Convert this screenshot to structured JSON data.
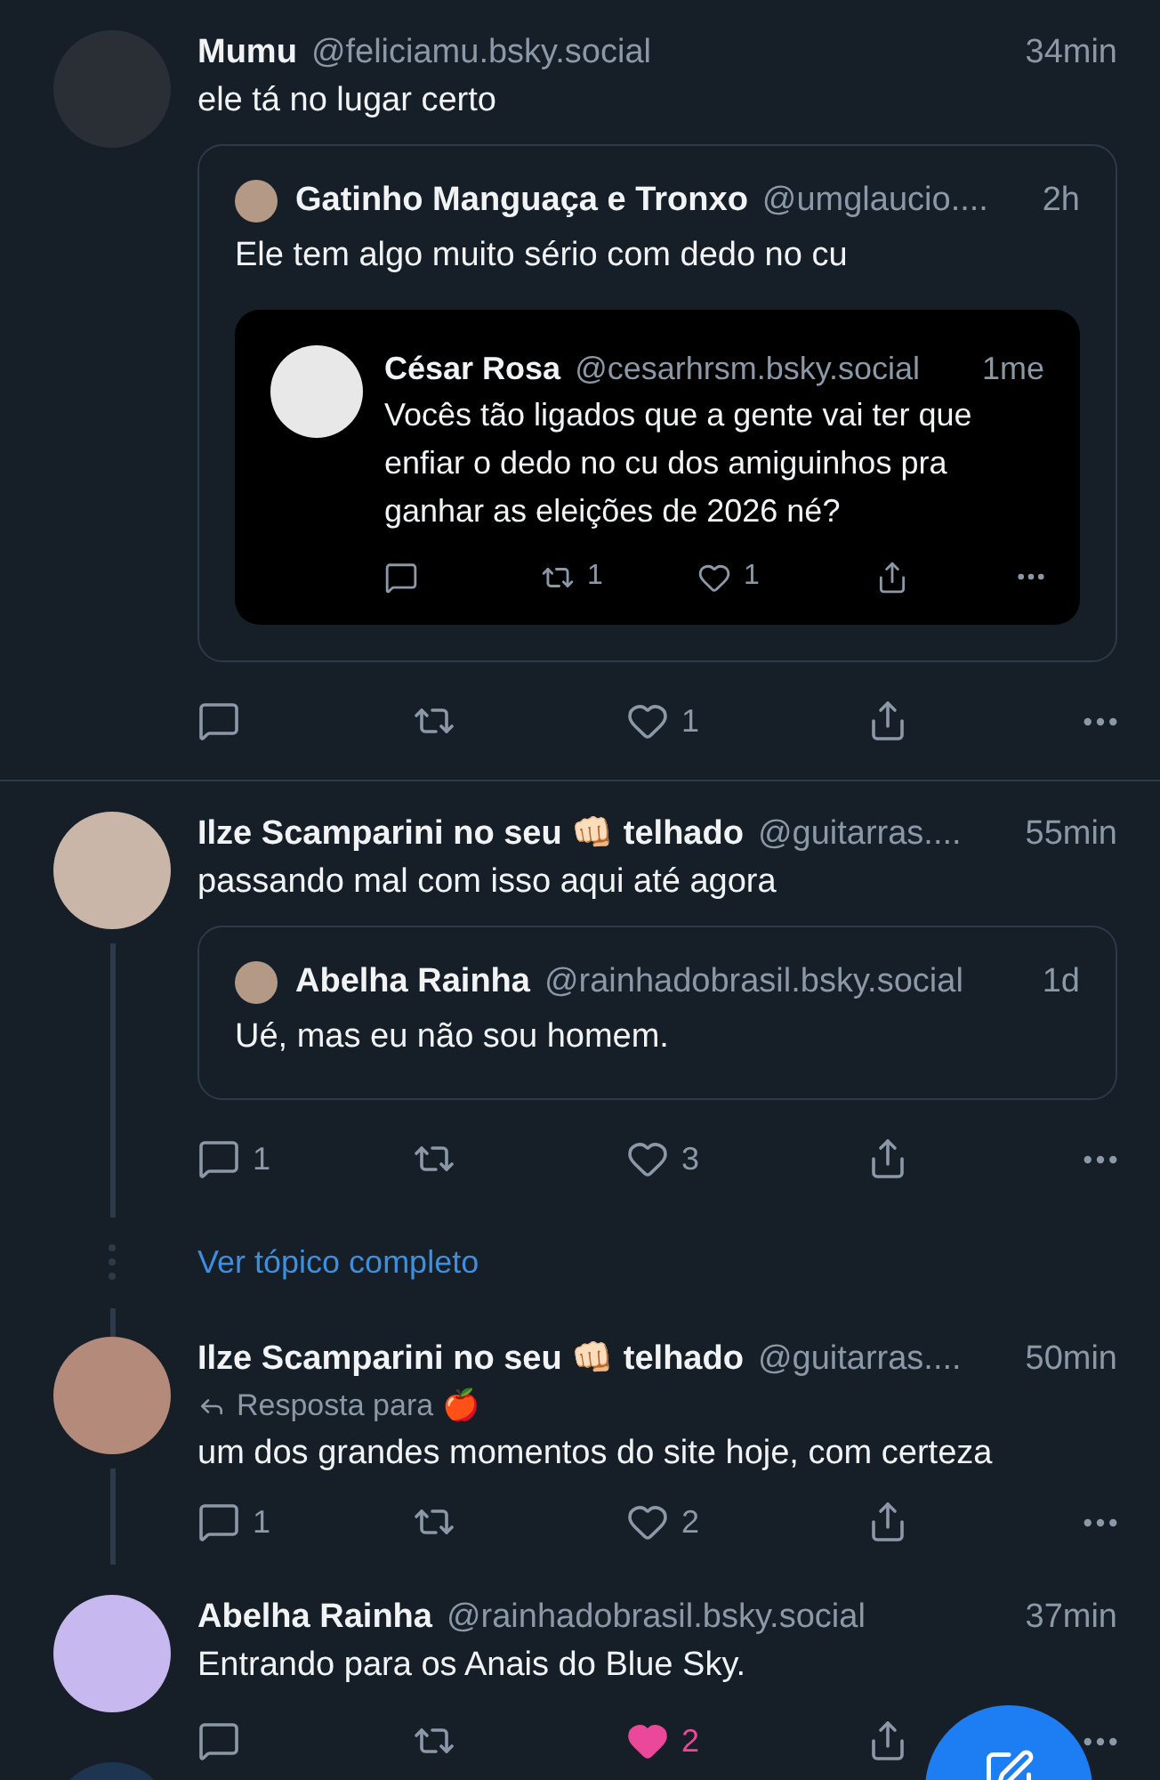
{
  "posts": [
    {
      "author": "Mumu",
      "handle": "@feliciamu.bsky.social",
      "time": "34min",
      "text": "ele tá no lugar certo",
      "divider_above": false,
      "line_above": false,
      "line_below": false,
      "quote": {
        "author": "Gatinho Manguaça e Tronxo",
        "handle": "@umglaucio....",
        "time": "2h",
        "text": "Ele tem algo muito sério com dedo no cu",
        "quote": {
          "author": "César Rosa",
          "handle": "@cesarhrsm.bsky.social",
          "time": "1me",
          "text": "Vocês tão ligados que a gente vai ter que enfiar o dedo no cu dos amiguinhos pra ganhar as eleições de 2026 né?",
          "actions": [
            {
              "kind": "reply"
            },
            {
              "kind": "repost",
              "count": "1"
            },
            {
              "kind": "like",
              "count": "1",
              "liked": false
            },
            {
              "kind": "share"
            },
            {
              "kind": "more"
            }
          ]
        }
      },
      "actions": [
        {
          "kind": "reply"
        },
        {
          "kind": "repost"
        },
        {
          "kind": "like",
          "count": "1",
          "liked": false
        },
        {
          "kind": "share"
        },
        {
          "kind": "more"
        }
      ]
    },
    {
      "author": "Ilze Scamparini no seu 👊🏻 telhado",
      "handle": "@guitarras....",
      "time": "55min",
      "text": "passando mal com isso aqui até agora",
      "divider_above": true,
      "line_above": false,
      "line_below": true,
      "quote": {
        "author": "Abelha Rainha",
        "handle": "@rainhadobrasil.bsky.social",
        "time": "1d",
        "text": "Ué, mas eu não sou homem."
      },
      "actions": [
        {
          "kind": "reply",
          "count": "1"
        },
        {
          "kind": "repost"
        },
        {
          "kind": "like",
          "count": "3",
          "liked": false
        },
        {
          "kind": "share"
        },
        {
          "kind": "more"
        }
      ],
      "thread_link": "Ver tópico completo"
    },
    {
      "author": "Ilze Scamparini no seu 👊🏻 telhado",
      "handle": "@guitarras....",
      "time": "50min",
      "reply_to": "Resposta para 🍎",
      "text": "um dos grandes momentos do site hoje, com certeza",
      "divider_above": false,
      "line_above": true,
      "line_below": true,
      "actions": [
        {
          "kind": "reply",
          "count": "1"
        },
        {
          "kind": "repost"
        },
        {
          "kind": "like",
          "count": "2",
          "liked": false
        },
        {
          "kind": "share"
        },
        {
          "kind": "more"
        }
      ]
    },
    {
      "author": "Abelha Rainha",
      "handle": "@rainhadobrasil.bsky.social",
      "time": "37min",
      "text": "Entrando para os Anais do Blue Sky.",
      "divider_above": false,
      "line_above": false,
      "line_below": false,
      "actions": [
        {
          "kind": "reply"
        },
        {
          "kind": "repost"
        },
        {
          "kind": "like",
          "count": "2",
          "liked": true
        },
        {
          "kind": "share"
        },
        {
          "kind": "more"
        }
      ]
    }
  ]
}
